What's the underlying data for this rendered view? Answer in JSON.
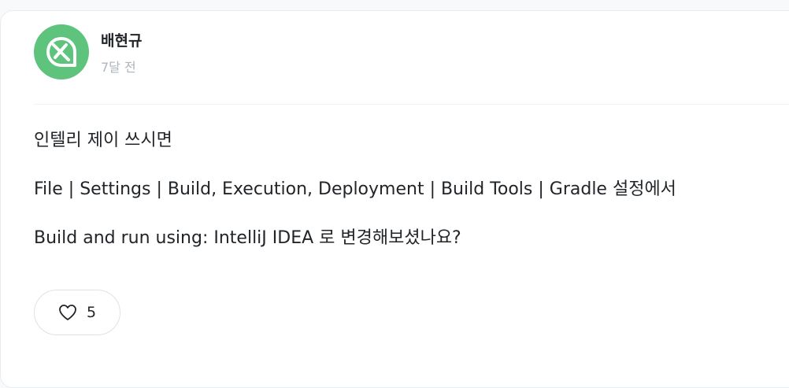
{
  "comment": {
    "author": "배현규",
    "time": "7달 전",
    "avatar_icon": "leaf-icon",
    "lines": [
      "인텔리 제이 쓰시면",
      "File | Settings | Build, Execution, Deployment | Build Tools | Gradle 설정에서",
      "Build and run using: IntelliJ IDEA 로 변경해보셨나요?"
    ],
    "likes": "5",
    "like_icon": "heart-outline-icon"
  },
  "colors": {
    "avatar_bg": "#5ec37d",
    "text": "#212529",
    "muted": "#adb5bd"
  }
}
